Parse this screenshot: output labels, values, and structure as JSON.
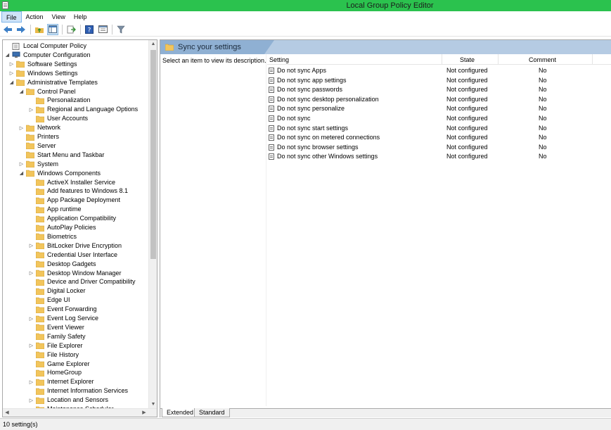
{
  "window": {
    "title": "Local Group Policy Editor"
  },
  "menu": [
    "File",
    "Action",
    "View",
    "Help"
  ],
  "toolbar": {
    "icons": [
      "back-arrow-icon",
      "forward-arrow-icon",
      "up-folder-icon",
      "show-hide-tree-icon",
      "export-list-icon",
      "help-icon",
      "properties-icon",
      "filter-icon"
    ]
  },
  "tree": [
    {
      "label": "Local Computer Policy",
      "depth": 0,
      "expander": "",
      "icon": "policy"
    },
    {
      "label": "Computer Configuration",
      "depth": 0,
      "expander": "open",
      "icon": "computer"
    },
    {
      "label": "Software Settings",
      "depth": 1,
      "expander": "closed",
      "icon": "folder"
    },
    {
      "label": "Windows Settings",
      "depth": 1,
      "expander": "closed",
      "icon": "folder"
    },
    {
      "label": "Administrative Templates",
      "depth": 1,
      "expander": "open",
      "icon": "folder"
    },
    {
      "label": "Control Panel",
      "depth": 2,
      "expander": "open",
      "icon": "folder"
    },
    {
      "label": "Personalization",
      "depth": 3,
      "expander": "",
      "icon": "folder"
    },
    {
      "label": "Regional and Language Options",
      "depth": 3,
      "expander": "closed",
      "icon": "folder"
    },
    {
      "label": "User Accounts",
      "depth": 3,
      "expander": "",
      "icon": "folder"
    },
    {
      "label": "Network",
      "depth": 2,
      "expander": "closed",
      "icon": "folder"
    },
    {
      "label": "Printers",
      "depth": 2,
      "expander": "",
      "icon": "folder"
    },
    {
      "label": "Server",
      "depth": 2,
      "expander": "",
      "icon": "folder"
    },
    {
      "label": "Start Menu and Taskbar",
      "depth": 2,
      "expander": "",
      "icon": "folder"
    },
    {
      "label": "System",
      "depth": 2,
      "expander": "closed",
      "icon": "folder"
    },
    {
      "label": "Windows Components",
      "depth": 2,
      "expander": "open",
      "icon": "folder"
    },
    {
      "label": "ActiveX Installer Service",
      "depth": 3,
      "expander": "",
      "icon": "folder"
    },
    {
      "label": "Add features to Windows 8.1",
      "depth": 3,
      "expander": "",
      "icon": "folder"
    },
    {
      "label": "App Package Deployment",
      "depth": 3,
      "expander": "",
      "icon": "folder"
    },
    {
      "label": "App runtime",
      "depth": 3,
      "expander": "",
      "icon": "folder"
    },
    {
      "label": "Application Compatibility",
      "depth": 3,
      "expander": "",
      "icon": "folder"
    },
    {
      "label": "AutoPlay Policies",
      "depth": 3,
      "expander": "",
      "icon": "folder"
    },
    {
      "label": "Biometrics",
      "depth": 3,
      "expander": "",
      "icon": "folder"
    },
    {
      "label": "BitLocker Drive Encryption",
      "depth": 3,
      "expander": "closed",
      "icon": "folder"
    },
    {
      "label": "Credential User Interface",
      "depth": 3,
      "expander": "",
      "icon": "folder"
    },
    {
      "label": "Desktop Gadgets",
      "depth": 3,
      "expander": "",
      "icon": "folder"
    },
    {
      "label": "Desktop Window Manager",
      "depth": 3,
      "expander": "closed",
      "icon": "folder"
    },
    {
      "label": "Device and Driver Compatibility",
      "depth": 3,
      "expander": "",
      "icon": "folder"
    },
    {
      "label": "Digital Locker",
      "depth": 3,
      "expander": "",
      "icon": "folder"
    },
    {
      "label": "Edge UI",
      "depth": 3,
      "expander": "",
      "icon": "folder"
    },
    {
      "label": "Event Forwarding",
      "depth": 3,
      "expander": "",
      "icon": "folder"
    },
    {
      "label": "Event Log Service",
      "depth": 3,
      "expander": "closed",
      "icon": "folder"
    },
    {
      "label": "Event Viewer",
      "depth": 3,
      "expander": "",
      "icon": "folder"
    },
    {
      "label": "Family Safety",
      "depth": 3,
      "expander": "",
      "icon": "folder"
    },
    {
      "label": "File Explorer",
      "depth": 3,
      "expander": "closed",
      "icon": "folder"
    },
    {
      "label": "File History",
      "depth": 3,
      "expander": "",
      "icon": "folder"
    },
    {
      "label": "Game Explorer",
      "depth": 3,
      "expander": "",
      "icon": "folder"
    },
    {
      "label": "HomeGroup",
      "depth": 3,
      "expander": "",
      "icon": "folder"
    },
    {
      "label": "Internet Explorer",
      "depth": 3,
      "expander": "closed",
      "icon": "folder"
    },
    {
      "label": "Internet Information Services",
      "depth": 3,
      "expander": "",
      "icon": "folder"
    },
    {
      "label": "Location and Sensors",
      "depth": 3,
      "expander": "closed",
      "icon": "folder"
    },
    {
      "label": "Maintenance Scheduler",
      "depth": 3,
      "expander": "",
      "icon": "folder"
    }
  ],
  "right": {
    "header_title": "Sync your settings",
    "description": "Select an item to view its description.",
    "columns": [
      "Setting",
      "State",
      "Comment"
    ],
    "rows": [
      [
        "Do not sync Apps",
        "Not configured",
        "No"
      ],
      [
        "Do not sync app settings",
        "Not configured",
        "No"
      ],
      [
        "Do not sync passwords",
        "Not configured",
        "No"
      ],
      [
        "Do not sync desktop personalization",
        "Not configured",
        "No"
      ],
      [
        "Do not sync personalize",
        "Not configured",
        "No"
      ],
      [
        "Do not sync",
        "Not configured",
        "No"
      ],
      [
        "Do not sync start settings",
        "Not configured",
        "No"
      ],
      [
        "Do not sync on metered connections",
        "Not configured",
        "No"
      ],
      [
        "Do not sync browser settings",
        "Not configured",
        "No"
      ],
      [
        "Do not sync other Windows settings",
        "Not configured",
        "No"
      ]
    ],
    "tabs": [
      "Extended",
      "Standard"
    ]
  },
  "status": {
    "text": "10 setting(s)"
  },
  "colors": {
    "titlebar": "#2bc24e",
    "header_band": "#b5cbe3",
    "header_tab": "#8fb0d3",
    "folder": "#f2c55c"
  }
}
